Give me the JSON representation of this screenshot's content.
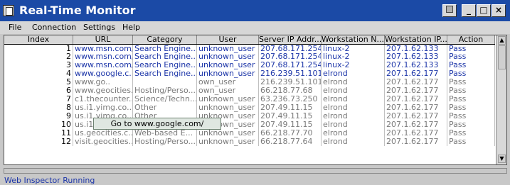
{
  "window": {
    "title": "Real-Time Monitor"
  },
  "menu": [
    "File",
    "Connection",
    "Settings",
    "Help"
  ],
  "columns": [
    "Index",
    "URL",
    "Category",
    "User",
    "Server IP Addr...",
    "Workstation N...",
    "Workstation IP...",
    "Action"
  ],
  "rows": [
    {
      "index": "1",
      "url": "www.msn.com/",
      "category": "Search Engine..",
      "user": "unknown_user",
      "server_ip": "207.68.171.254",
      "ws_name": "linux-2",
      "ws_ip": "207.1.62.133",
      "action": "Pass"
    },
    {
      "index": "2",
      "url": "www.msn.com/",
      "category": "Search Engine..",
      "user": "unknown_user",
      "server_ip": "207.68.171.254",
      "ws_name": "linux-2",
      "ws_ip": "207.1.62.133",
      "action": "Pass"
    },
    {
      "index": "3",
      "url": "www.msn.com/",
      "category": "Search Engine..",
      "user": "unknown_user",
      "server_ip": "207.68.171.254",
      "ws_name": "linux-2",
      "ws_ip": "207.1.62.133",
      "action": "Pass"
    },
    {
      "index": "4",
      "url": "www.google.c..",
      "category": "Search Engine..",
      "user": "unknown_user",
      "server_ip": "216.239.51.101",
      "ws_name": "elrond",
      "ws_ip": "207.1.62.177",
      "action": "Pass"
    },
    {
      "index": "5",
      "url": "www.go..",
      "category": "",
      "user": "own_user",
      "server_ip": "216.239.51.101",
      "ws_name": "elrond",
      "ws_ip": "207.1.62.177",
      "action": "Pass"
    },
    {
      "index": "6",
      "url": "www.geocities...",
      "category": "Hosting/Perso...",
      "user": "own_user",
      "server_ip": "66.218.77.68",
      "ws_name": "elrond",
      "ws_ip": "207.1.62.177",
      "action": "Pass"
    },
    {
      "index": "7",
      "url": "c1.thecounter....",
      "category": "Science/Techn...",
      "user": "unknown_user",
      "server_ip": "63.236.73.250",
      "ws_name": "elrond",
      "ws_ip": "207.1.62.177",
      "action": "Pass"
    },
    {
      "index": "8",
      "url": "us.i1.yimg.co...",
      "category": "Other",
      "user": "unknown_user",
      "server_ip": "207.49.11.15",
      "ws_name": "elrond",
      "ws_ip": "207.1.62.177",
      "action": "Pass"
    },
    {
      "index": "9",
      "url": "us.i1.yimg.co...",
      "category": "Other",
      "user": "unknown_user",
      "server_ip": "207.49.11.15",
      "ws_name": "elrond",
      "ws_ip": "207.1.62.177",
      "action": "Pass"
    },
    {
      "index": "10",
      "url": "us.i1.yimg.co...",
      "category": "Other",
      "user": "unknown_user",
      "server_ip": "207.49.11.15",
      "ws_name": "elrond",
      "ws_ip": "207.1.62.177",
      "action": "Pass"
    },
    {
      "index": "11",
      "url": "us.geocities.c...",
      "category": "Web-based E...",
      "user": "unknown_user",
      "server_ip": "66.218.77.70",
      "ws_name": "elrond",
      "ws_ip": "207.1.62.177",
      "action": "Pass"
    },
    {
      "index": "12",
      "url": "visit.geocities...",
      "category": "Hosting/Perso...",
      "user": "unknown_user",
      "server_ip": "66.218.77.64",
      "ws_name": "elrond",
      "ws_ip": "207.1.62.177",
      "action": "Pass"
    }
  ],
  "tooltip": "Go to www.google.com/",
  "status": "Web Inspector Running",
  "colors": {
    "titlebar": "#1b4aa6",
    "link_text": "#1c35a8",
    "visited_text": "#7a7a7a"
  }
}
